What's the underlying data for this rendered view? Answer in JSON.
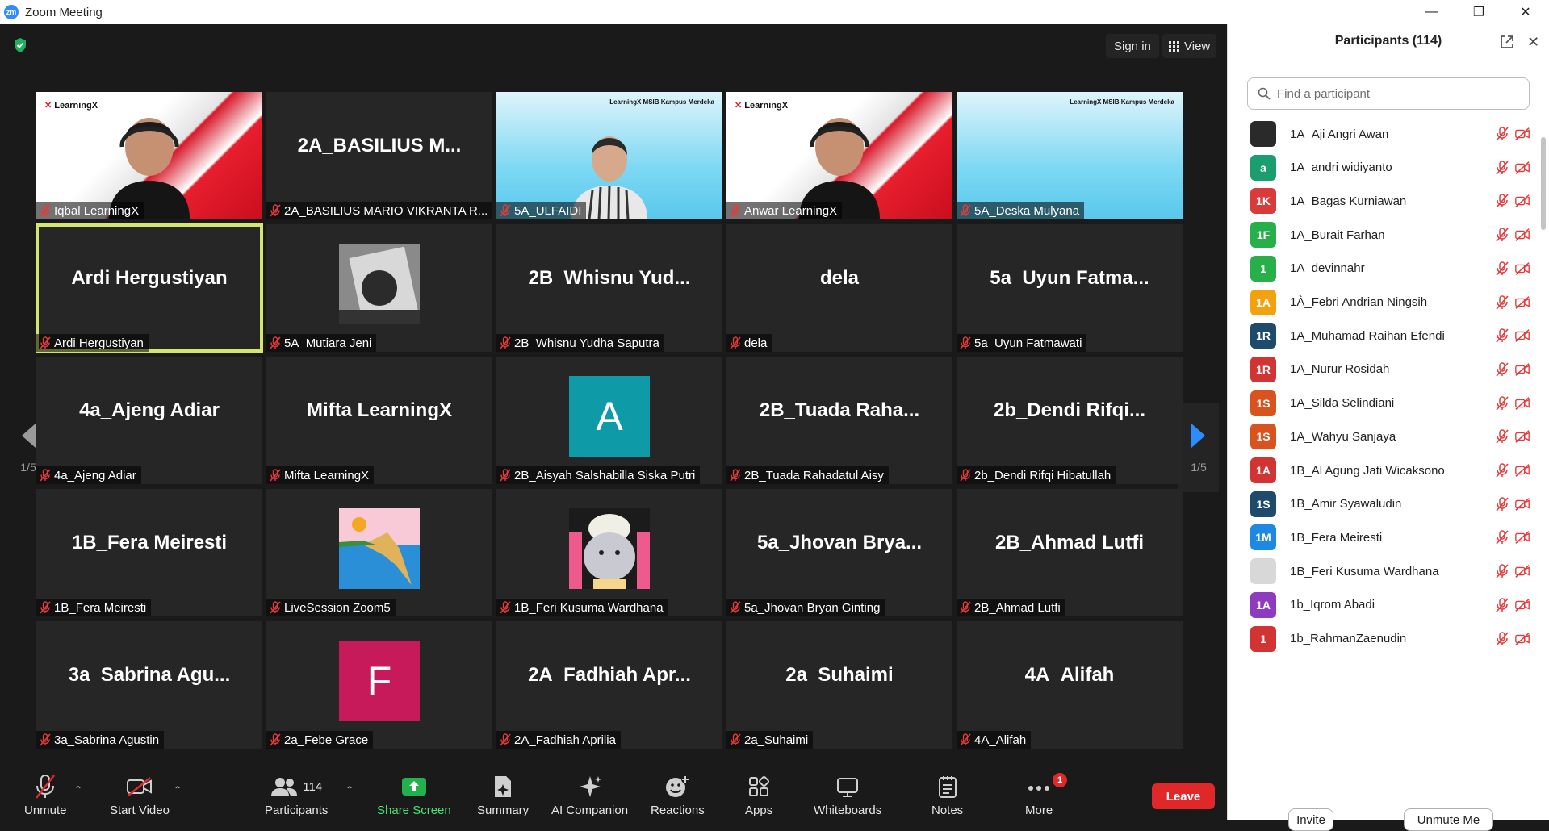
{
  "window": {
    "title": "Zoom Meeting",
    "logo_text": "zm",
    "minimize": "—",
    "restore": "❐",
    "close": "✕"
  },
  "top": {
    "sign_in": "Sign in",
    "view": "View"
  },
  "pagination": {
    "left": "1/5",
    "right": "1/5"
  },
  "brand": {
    "learningx": "LearningX",
    "partners": "LearningX  MSIB  Kampus Merdeka"
  },
  "tiles": [
    {
      "big": "",
      "label": "Iqbal LearningX",
      "kind": "video-red"
    },
    {
      "big": "2A_BASILIUS  M...",
      "label": "2A_BASILIUS MARIO VIKRANTA R...",
      "kind": "name"
    },
    {
      "big": "",
      "label": "5A_ULFAIDI",
      "kind": "video-blue"
    },
    {
      "big": "",
      "label": "Anwar LearningX",
      "kind": "video-red"
    },
    {
      "big": "",
      "label": "5A_Deska Mulyana",
      "kind": "video-blue-empty"
    },
    {
      "big": "Ardi Hergustiyan",
      "label": "Ardi Hergustiyan",
      "kind": "name"
    },
    {
      "big": "",
      "label": "5A_Mutiara Jeni",
      "kind": "photo-bw"
    },
    {
      "big": "2B_Whisnu  Yud...",
      "label": "2B_Whisnu Yudha Saputra",
      "kind": "name"
    },
    {
      "big": "dela",
      "label": "dela",
      "kind": "name"
    },
    {
      "big": "5a_Uyun  Fatma...",
      "label": "5a_Uyun Fatmawati",
      "kind": "name"
    },
    {
      "big": "4a_Ajeng Adiar",
      "label": "4a_Ajeng Adiar",
      "kind": "name"
    },
    {
      "big": "Mifta LearningX",
      "label": "Mifta LearningX",
      "kind": "name"
    },
    {
      "big": "A",
      "label": "2B_Aisyah Salshabilla Siska Putri",
      "kind": "letter",
      "color": "#0f9aa8"
    },
    {
      "big": "2B_Tuada  Raha...",
      "label": "2B_Tuada Rahadatul Aisy",
      "kind": "name"
    },
    {
      "big": "2b_Dendi  Rifqi...",
      "label": "2b_Dendi Rifqi Hibatullah",
      "kind": "name"
    },
    {
      "big": "1B_Fera Meiresti",
      "label": "1B_Fera Meiresti",
      "kind": "name"
    },
    {
      "big": "",
      "label": "LiveSession Zoom5",
      "kind": "photo-landscape"
    },
    {
      "big": "",
      "label": "1B_Feri Kusuma Wardhana",
      "kind": "photo-cat"
    },
    {
      "big": "5a_Jhovan  Brya...",
      "label": "5a_Jhovan Bryan Ginting",
      "kind": "name"
    },
    {
      "big": "2B_Ahmad Lutfi",
      "label": "2B_Ahmad Lutfi",
      "kind": "name"
    },
    {
      "big": "3a_Sabrina  Agu...",
      "label": "3a_Sabrina Agustin",
      "kind": "name"
    },
    {
      "big": "F",
      "label": "2a_Febe Grace",
      "kind": "letter",
      "color": "#c71a5a"
    },
    {
      "big": "2A_Fadhiah  Apr...",
      "label": "2A_Fadhiah Aprilia",
      "kind": "name"
    },
    {
      "big": "2a_Suhaimi",
      "label": "2a_Suhaimi",
      "kind": "name"
    },
    {
      "big": "4A_Alifah",
      "label": "4A_Alifah",
      "kind": "name"
    }
  ],
  "toolbar": {
    "unmute": "Unmute",
    "start_video": "Start Video",
    "participants": "Participants",
    "participants_count": "114",
    "share_screen": "Share Screen",
    "summary": "Summary",
    "ai_companion": "AI Companion",
    "reactions": "Reactions",
    "apps": "Apps",
    "whiteboards": "Whiteboards",
    "notes": "Notes",
    "more": "More",
    "more_badge": "1",
    "leave": "Leave"
  },
  "panel": {
    "title": "Participants (114)",
    "search_placeholder": "Find a participant",
    "invite": "Invite",
    "unmute_me": "Unmute Me",
    "participants": [
      {
        "initials": "",
        "name": "1A_Aji Angri Awan",
        "color": "#2a2a2a",
        "photo": true
      },
      {
        "initials": "a",
        "name": "1A_andri widiyanto",
        "color": "#1b9e6f"
      },
      {
        "initials": "1K",
        "name": "1A_Bagas Kurniawan",
        "color": "#d93a3a"
      },
      {
        "initials": "1F",
        "name": "1A_Burait Farhan",
        "color": "#27b04a"
      },
      {
        "initials": "1",
        "name": "1A_devinnahr",
        "color": "#27b04a"
      },
      {
        "initials": "1A",
        "name": "1À_Febri Andrian Ningsih",
        "color": "#f2a20c"
      },
      {
        "initials": "1R",
        "name": "1A_Muhamad Raihan Efendi",
        "color": "#1e4b6b"
      },
      {
        "initials": "1R",
        "name": "1A_Nurur Rosidah",
        "color": "#d23333"
      },
      {
        "initials": "1S",
        "name": "1A_Silda Selindiani",
        "color": "#d9531e"
      },
      {
        "initials": "1S",
        "name": "1A_Wahyu Sanjaya",
        "color": "#d9531e"
      },
      {
        "initials": "1A",
        "name": "1B_Al Agung Jati Wicaksono",
        "color": "#d23333"
      },
      {
        "initials": "1S",
        "name": "1B_Amir Syawaludin",
        "color": "#1e4b6b"
      },
      {
        "initials": "1M",
        "name": "1B_Fera Meiresti",
        "color": "#1e88e5"
      },
      {
        "initials": "",
        "name": "1B_Feri Kusuma Wardhana",
        "color": "#d8d8d8",
        "photo": true
      },
      {
        "initials": "1A",
        "name": "1b_Iqrom Abadi",
        "color": "#8e3bbf"
      },
      {
        "initials": "1",
        "name": "1b_RahmanZaenudin",
        "color": "#d23333"
      }
    ]
  },
  "colors": {
    "accent_green": "#4ae171",
    "leave_red": "#e02828",
    "active_border": "#d5e66f",
    "muted_red": "#e02828"
  }
}
